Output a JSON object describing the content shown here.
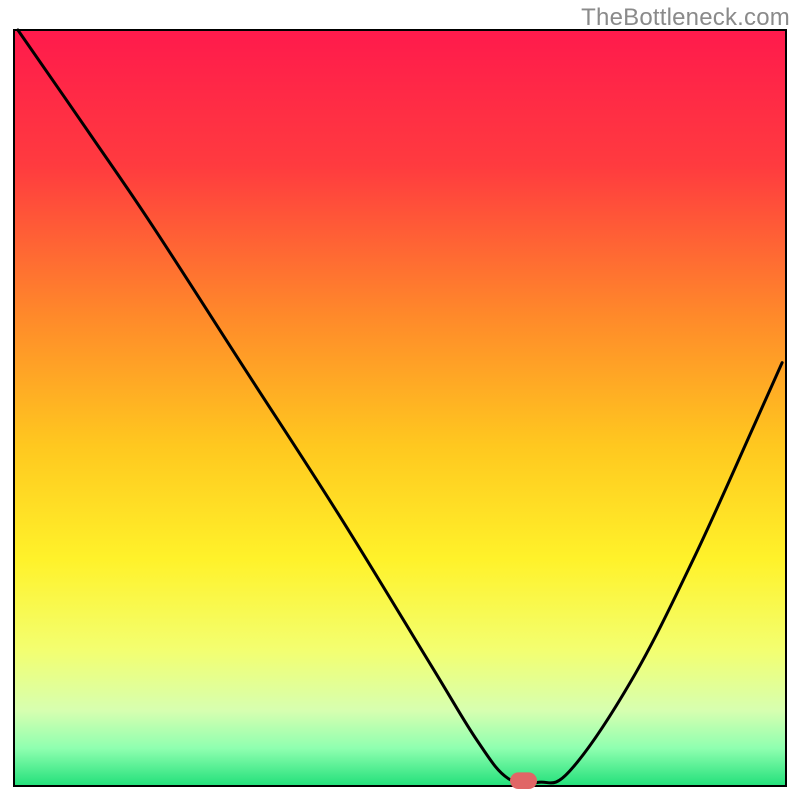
{
  "watermark": "TheBottleneck.com",
  "chart_data": {
    "type": "line",
    "title": "",
    "xlabel": "",
    "ylabel": "",
    "xlim": [
      0,
      100
    ],
    "ylim": [
      0,
      100
    ],
    "axes_visible": false,
    "grid": false,
    "gradient_fill": {
      "type": "vertical",
      "stops": [
        {
          "offset": 0.0,
          "color": "#ff1a4c"
        },
        {
          "offset": 0.18,
          "color": "#ff3b3f"
        },
        {
          "offset": 0.38,
          "color": "#ff8a2a"
        },
        {
          "offset": 0.55,
          "color": "#ffc81f"
        },
        {
          "offset": 0.7,
          "color": "#fff22a"
        },
        {
          "offset": 0.82,
          "color": "#f3ff70"
        },
        {
          "offset": 0.9,
          "color": "#d7ffb0"
        },
        {
          "offset": 0.95,
          "color": "#8fffb0"
        },
        {
          "offset": 1.0,
          "color": "#22e07a"
        }
      ]
    },
    "series": [
      {
        "name": "bottleneck-curve",
        "color": "#000000",
        "x": [
          0.5,
          10,
          18,
          30,
          42,
          54,
          60,
          64,
          68,
          72,
          80,
          88,
          96,
          99.5
        ],
        "values": [
          100,
          86,
          74,
          55,
          36,
          16,
          6,
          1,
          0.5,
          2,
          14,
          30,
          48,
          56
        ]
      }
    ],
    "marker": {
      "name": "optimal-point",
      "x": 66,
      "y": 0.7,
      "color": "#e06666",
      "width": 3.5,
      "height": 2.2
    },
    "frame": {
      "color": "#000000",
      "stroke_width": 2
    }
  }
}
